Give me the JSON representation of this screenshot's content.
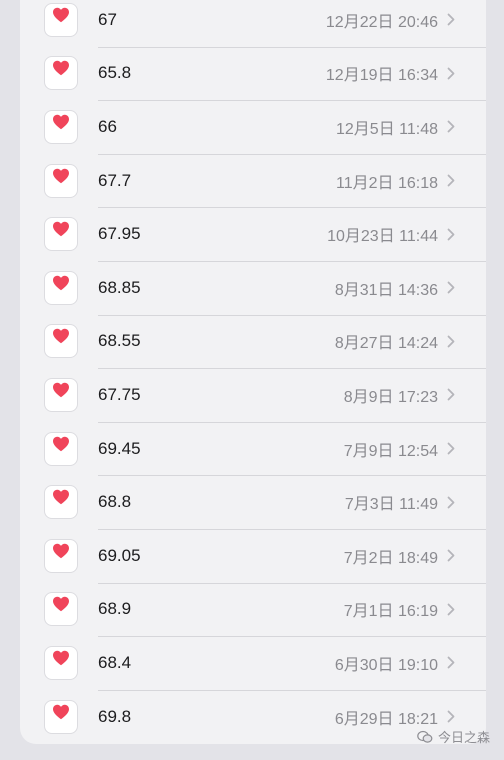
{
  "colors": {
    "heart": "#f0445a",
    "date": "#8a8a8f",
    "value": "#1c1c1e"
  },
  "icon": "heart-icon",
  "records": [
    {
      "value": "67",
      "date": "12月22日 20:46"
    },
    {
      "value": "65.8",
      "date": "12月19日 16:34"
    },
    {
      "value": "66",
      "date": "12月5日 11:48"
    },
    {
      "value": "67.7",
      "date": "11月2日 16:18"
    },
    {
      "value": "67.95",
      "date": "10月23日 11:44"
    },
    {
      "value": "68.85",
      "date": "8月31日 14:36"
    },
    {
      "value": "68.55",
      "date": "8月27日 14:24"
    },
    {
      "value": "67.75",
      "date": "8月9日 17:23"
    },
    {
      "value": "69.45",
      "date": "7月9日 12:54"
    },
    {
      "value": "68.8",
      "date": "7月3日 11:49"
    },
    {
      "value": "69.05",
      "date": "7月2日 18:49"
    },
    {
      "value": "68.9",
      "date": "7月1日 16:19"
    },
    {
      "value": "68.4",
      "date": "6月30日 19:10"
    },
    {
      "value": "69.8",
      "date": "6月29日 18:21"
    }
  ],
  "watermark": {
    "text": "今日之森",
    "icon": "wechat-icon"
  }
}
